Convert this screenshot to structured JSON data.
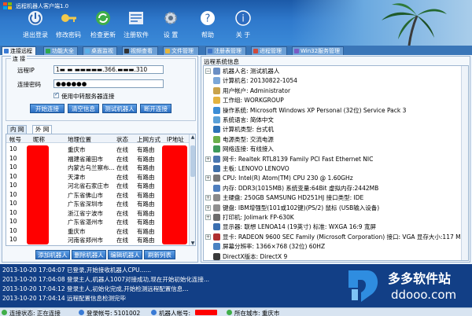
{
  "window": {
    "title": "远程机器人客户端1.0"
  },
  "toolbar": [
    {
      "label": "退出登录",
      "icon": "logout-icon"
    },
    {
      "label": "修改密码",
      "icon": "key-icon"
    },
    {
      "label": "检查更新",
      "icon": "update-icon"
    },
    {
      "label": "注册软件",
      "icon": "register-icon"
    },
    {
      "label": "设 置",
      "icon": "settings-icon"
    },
    {
      "label": "帮助",
      "icon": "help-icon"
    },
    {
      "label": "关 于",
      "icon": "about-icon"
    }
  ],
  "tabs": [
    "连接远程",
    "功能大全",
    "桌面监视",
    "视频查看",
    "文件管理",
    "注册表管理",
    "进程管理",
    "Win32服务管理"
  ],
  "connect": {
    "group_title": "连 接",
    "ip_label": "远程IP",
    "ip_value": "1▬   ▬   ▬▬▬▬▬.366.▬▬▬.310",
    "pwd_label": "连接密码",
    "pwd_value": "●●●●●●",
    "relay_label": "使用中转服务器连接",
    "buttons": [
      "开始连接",
      "清空信息",
      "测试机器人",
      "断开连接"
    ]
  },
  "net_tabs": [
    "内 网",
    "外 网"
  ],
  "robot_list": {
    "columns": [
      "帐号",
      "昵称",
      "地理位置",
      "状态",
      "上网方式",
      "IP地址"
    ],
    "rows": [
      {
        "acct": "10",
        "loc": "重庆市",
        "status": "在线",
        "net": "有路由"
      },
      {
        "acct": "10",
        "loc": "福建省莆田市",
        "status": "在线",
        "net": "有路由"
      },
      {
        "acct": "10",
        "loc": "内蒙古乌兰察布...",
        "status": "在线",
        "net": "有路由"
      },
      {
        "acct": "10",
        "loc": "天津市",
        "status": "在线",
        "net": "有路由"
      },
      {
        "acct": "10",
        "loc": "河北省石家庄市",
        "status": "在线",
        "net": "有路由"
      },
      {
        "acct": "10",
        "loc": "广东省佛山市",
        "status": "在线",
        "net": "有路由"
      },
      {
        "acct": "10",
        "loc": "广东省深圳市",
        "status": "在线",
        "net": "有路由"
      },
      {
        "acct": "10",
        "loc": "浙江省宁波市",
        "status": "在线",
        "net": "有路由"
      },
      {
        "acct": "10",
        "loc": "广东省湛州市",
        "status": "在线",
        "net": "有路由"
      },
      {
        "acct": "10",
        "loc": "重庆市",
        "status": "在线",
        "net": "有路由"
      },
      {
        "acct": "10",
        "loc": "河南省郑州市",
        "status": "在线",
        "net": "有路由"
      }
    ],
    "buttons": [
      "添加机器人",
      "删除机器人",
      "编辑机器人",
      "刷新列表"
    ]
  },
  "sysinfo": {
    "title": "远程系统信息",
    "items": [
      {
        "exp": "−",
        "text": "机器人名: 测试机器人",
        "color": "#6b8fc4"
      },
      {
        "exp": "",
        "text": "计算机名: 20130822-1054",
        "color": "#7ba7d9"
      },
      {
        "exp": "",
        "text": "用户帐户: Administrator",
        "color": "#c9a24a"
      },
      {
        "exp": "",
        "text": "工作组: WORKGROUP",
        "color": "#e3b341"
      },
      {
        "exp": "",
        "text": "操作系统: Microsoft Windows XP Personal (32位) Service Pack 3",
        "color": "#3c8dd6"
      },
      {
        "exp": "",
        "text": "系统语言: 简体中文",
        "color": "#5aa0d8"
      },
      {
        "exp": "",
        "text": "计算机类型: 台式机",
        "color": "#2e73b8"
      },
      {
        "exp": "",
        "text": "电源类型: 交流电源",
        "color": "#6cb04a"
      },
      {
        "exp": "",
        "text": "网络连接: 有线接入",
        "color": "#3e9a5a"
      },
      {
        "exp": "+",
        "text": "网卡: Realtek RTL8139 Family PCI Fast Ethernet NIC",
        "color": "#4b77b0"
      },
      {
        "exp": "",
        "text": "主板: LENOVO LENOVO",
        "color": "#3f6fa8"
      },
      {
        "exp": "+",
        "text": "CPU:        Intel(R) Atom(TM) CPU  230  @ 1.60GHz",
        "color": "#777"
      },
      {
        "exp": "",
        "text": "内存: DDR3(1015MB)  系统变量:64Bit  虚拟内存:2442MB",
        "color": "#4f7fbf"
      },
      {
        "exp": "+",
        "text": "主硬盘: 250GB  SAMSUNG HD251HJ  接口类型: IDE",
        "color": "#8a8a8a"
      },
      {
        "exp": "+",
        "text": "键盘: IBM增强型(101或102键)(PS/2)   鼠标 (USB输入设备)",
        "color": "#909090"
      },
      {
        "exp": "+",
        "text": "打印机: Jolimark FP-630K",
        "color": "#6d6d6d"
      },
      {
        "exp": "",
        "text": "显示器: 联想  LENOA14 (19英寸)  标准: WXGA  16:9 宽屏",
        "color": "#3b6fb0"
      },
      {
        "exp": "+",
        "text": "显卡: RADEON 9600 SEC Family (Microsoft Corporation)  接口: VGA  显存大小:117 MB",
        "color": "#b03030"
      },
      {
        "exp": "",
        "text": "屏幕分辨率: 1366×768 (32位) 60HZ",
        "color": "#4a82c2"
      },
      {
        "exp": "",
        "text": "DirectX版本: DirectX 9",
        "color": "#3a3a3a"
      }
    ]
  },
  "log": [
    "2013-10-20 17:04:07 已登录,开始接收机器人CPU......",
    "2013-10-20 17:04:08 登录主人,机器人1007对接成功,现在开始初始化连接...",
    "2013-10-20 17:04:12 登录主人,初始化完成,开始检测远程配置信息...",
    "2013-10-20 17:04:14 远程配置信息检测完毕"
  ],
  "watermark": {
    "brand": "多多软件站",
    "url": "ddooo.com"
  },
  "status": {
    "conn": "连接状态: 正在连接",
    "login": "登录帐号: 5101002",
    "robot": "机器人帐号:",
    "city": "所在城市: 重庆市"
  },
  "colors": {
    "toolbar": "#2f79cc",
    "accent": "#2c6fc2",
    "log_bg": "#123f86",
    "mask": "#ff0000"
  }
}
